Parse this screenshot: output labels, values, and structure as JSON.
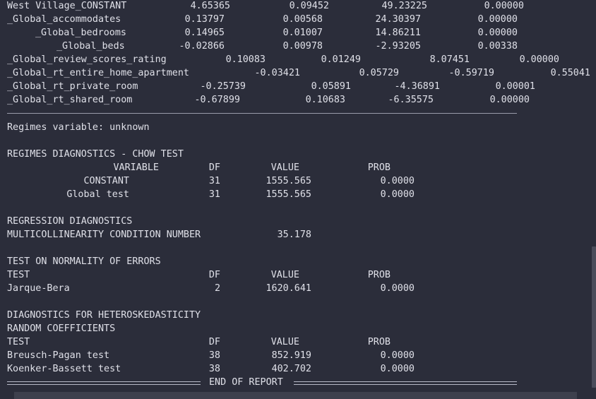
{
  "coef_rows": [
    {
      "name": "West Village_CONSTANT",
      "coef": "4.65365",
      "se": "0.09452",
      "z": "49.23225",
      "p": "0.00000"
    },
    {
      "name": "_Global_accommodates",
      "coef": "0.13797",
      "se": "0.00568",
      "z": "24.30397",
      "p": "0.00000"
    },
    {
      "name": "_Global_bedrooms",
      "coef": "0.14965",
      "se": "0.01007",
      "z": "14.86211",
      "p": "0.00000"
    },
    {
      "name": "_Global_beds",
      "coef": "-0.02866",
      "se": "0.00978",
      "z": "-2.93205",
      "p": "0.00338"
    },
    {
      "name": "_Global_review_scores_rating",
      "coef": "0.10083",
      "se": "0.01249",
      "z": "8.07451",
      "p": "0.00000"
    },
    {
      "name": "_Global_rt_entire_home_apartment",
      "coef": "-0.03421",
      "se": "0.05729",
      "z": "-0.59719",
      "p": "0.55041"
    },
    {
      "name": "_Global_rt_private_room",
      "coef": "-0.25739",
      "se": "0.05891",
      "z": "-4.36891",
      "p": "0.00001"
    },
    {
      "name": "_Global_rt_shared_room",
      "coef": "-0.67899",
      "se": "0.10683",
      "z": "-6.35575",
      "p": "0.00000"
    }
  ],
  "regimes_variable": "Regimes variable: unknown",
  "chow": {
    "title": "REGIMES DIAGNOSTICS - CHOW TEST",
    "headers": {
      "col1": "VARIABLE",
      "df": "DF",
      "value": "VALUE",
      "prob": "PROB"
    },
    "rows": [
      {
        "name": "CONSTANT",
        "df": "31",
        "value": "1555.565",
        "prob": "0.0000"
      },
      {
        "name": "Global test",
        "df": "31",
        "value": "1555.565",
        "prob": "0.0000"
      }
    ]
  },
  "regression": {
    "title": "REGRESSION DIAGNOSTICS",
    "label": "MULTICOLLINEARITY CONDITION NUMBER",
    "value": "35.178"
  },
  "normality": {
    "title": "TEST ON NORMALITY OF ERRORS",
    "headers": {
      "col1": "TEST",
      "df": "DF",
      "value": "VALUE",
      "prob": "PROB"
    },
    "rows": [
      {
        "name": "Jarque-Bera",
        "df": "2",
        "value": "1620.641",
        "prob": "0.0000"
      }
    ]
  },
  "hetero": {
    "title": "DIAGNOSTICS FOR HETEROSKEDASTICITY",
    "subtitle": "RANDOM COEFFICIENTS",
    "headers": {
      "col1": "TEST",
      "df": "DF",
      "value": "VALUE",
      "prob": "PROB"
    },
    "rows": [
      {
        "name": "Breusch-Pagan test",
        "df": "38",
        "value": "852.919",
        "prob": "0.0000"
      },
      {
        "name": "Koenker-Bassett test",
        "df": "38",
        "value": "402.702",
        "prob": "0.0000"
      }
    ]
  },
  "footer": "END OF REPORT",
  "colors": {
    "background": "#2b2d3a",
    "text": "#dfe0e8",
    "rule": "#9a9cab"
  }
}
